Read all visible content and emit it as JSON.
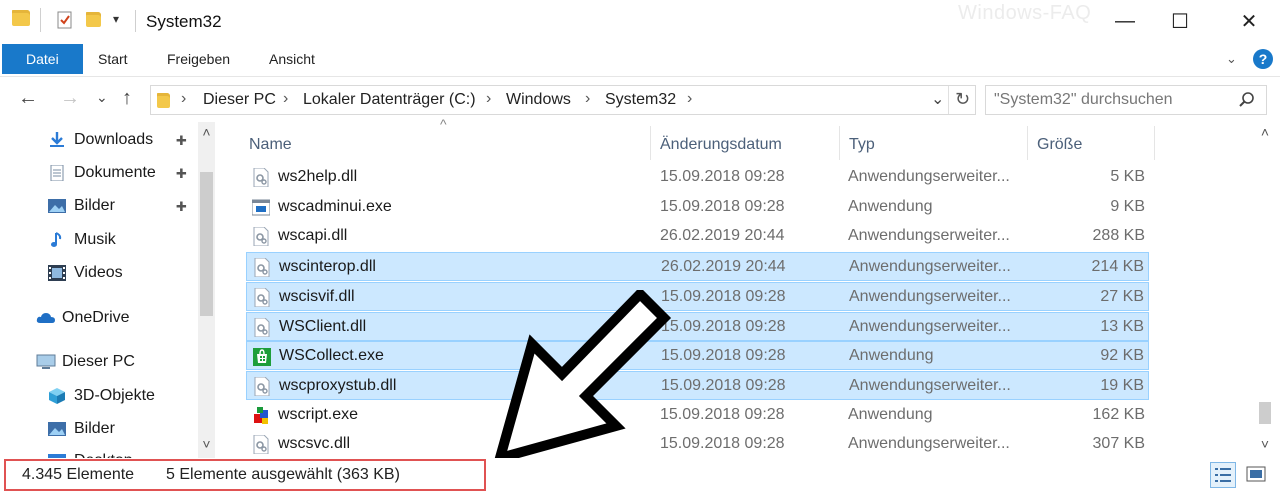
{
  "window": {
    "title": "System32",
    "watermark": "Windows-FAQ",
    "minimize": "—",
    "maximize": "☐",
    "close": "✕"
  },
  "ribbon": {
    "tabs": [
      "Datei",
      "Start",
      "Freigeben",
      "Ansicht"
    ],
    "expand_chevron": "⌄",
    "help": "?"
  },
  "nav": {
    "back": "←",
    "forward": "→",
    "recent": "⌄",
    "up": "↑",
    "breadcrumb": [
      "Dieser PC",
      "Lokaler Datenträger (C:)",
      "Windows",
      "System32"
    ],
    "breadcrumb_sep": "›",
    "dropdown": "⌄",
    "refresh": "↻"
  },
  "search": {
    "placeholder": "\"System32\" durchsuchen"
  },
  "sidebar": {
    "items": [
      {
        "label": "Downloads",
        "icon": "download-arrow-icon",
        "pinned": true
      },
      {
        "label": "Dokumente",
        "icon": "document-icon",
        "pinned": true
      },
      {
        "label": "Bilder",
        "icon": "pictures-icon",
        "pinned": true
      },
      {
        "label": "Musik",
        "icon": "music-note-icon",
        "pinned": false
      },
      {
        "label": "Videos",
        "icon": "film-icon",
        "pinned": false
      },
      {
        "label": "OneDrive",
        "icon": "cloud-icon",
        "pinned": false
      },
      {
        "label": "Dieser PC",
        "icon": "computer-icon",
        "pinned": false
      },
      {
        "label": "3D-Objekte",
        "icon": "cube-icon",
        "pinned": false
      },
      {
        "label": "Bilder",
        "icon": "pictures-icon",
        "pinned": false
      },
      {
        "label": "Desktop",
        "icon": "desktop-icon",
        "pinned": false
      }
    ],
    "pin_glyph": "📌",
    "scroll_up": "˄",
    "scroll_down": "˅"
  },
  "columns": {
    "name": "Name",
    "date": "Änderungsdatum",
    "type": "Typ",
    "size": "Größe"
  },
  "files": [
    {
      "name": "ws2help.dll",
      "date": "15.09.2018 09:28",
      "type": "Anwendungserweiter...",
      "size": "5 KB",
      "selected": false,
      "icon": "dll"
    },
    {
      "name": "wscadminui.exe",
      "date": "15.09.2018 09:28",
      "type": "Anwendung",
      "size": "9 KB",
      "selected": false,
      "icon": "exe-window"
    },
    {
      "name": "wscapi.dll",
      "date": "26.02.2019 20:44",
      "type": "Anwendungserweiter...",
      "size": "288 KB",
      "selected": false,
      "icon": "dll"
    },
    {
      "name": "wscinterop.dll",
      "date": "26.02.2019 20:44",
      "type": "Anwendungserweiter...",
      "size": "214 KB",
      "selected": true,
      "icon": "dll"
    },
    {
      "name": "wscisvif.dll",
      "date": "15.09.2018 09:28",
      "type": "Anwendungserweiter...",
      "size": "27 KB",
      "selected": true,
      "icon": "dll"
    },
    {
      "name": "WSClient.dll",
      "date": "15.09.2018 09:28",
      "type": "Anwendungserweiter...",
      "size": "13 KB",
      "selected": true,
      "icon": "dll"
    },
    {
      "name": "WSCollect.exe",
      "date": "15.09.2018 09:28",
      "type": "Anwendung",
      "size": "92 KB",
      "selected": true,
      "icon": "store"
    },
    {
      "name": "wscproxystub.dll",
      "date": "15.09.2018 09:28",
      "type": "Anwendungserweiter...",
      "size": "19 KB",
      "selected": true,
      "icon": "dll"
    },
    {
      "name": "wscript.exe",
      "date": "15.09.2018 09:28",
      "type": "Anwendung",
      "size": "162 KB",
      "selected": false,
      "icon": "script"
    },
    {
      "name": "wscsvc.dll",
      "date": "15.09.2018 09:28",
      "type": "Anwendungserweiter...",
      "size": "307 KB",
      "selected": false,
      "icon": "dll"
    }
  ],
  "status": {
    "count": "4.345 Elemente",
    "selection": "5 Elemente ausgewählt (363 KB)"
  },
  "colors": {
    "accent": "#1979ca",
    "selection_bg": "#cce8ff",
    "selection_border": "#99d1ff",
    "highlight_box": "#e05252"
  }
}
